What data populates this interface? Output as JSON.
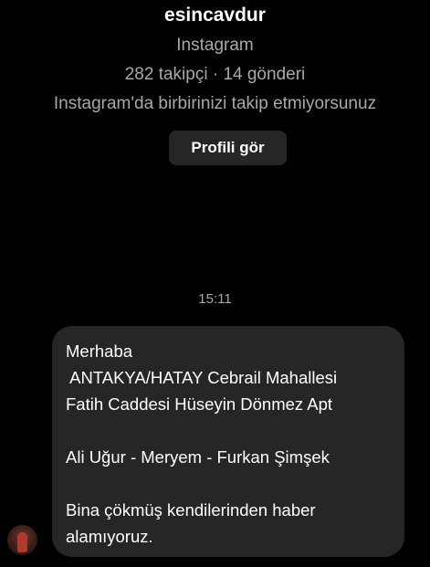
{
  "profile": {
    "username": "esincavdur",
    "app_name": "Instagram",
    "stats": "282 takipçi · 14 gönderi",
    "follow_note": "Instagram'da birbirinizi takip etmiyorsunuz",
    "view_profile_label": "Profili gör"
  },
  "conversation": {
    "timestamp": "15:11",
    "message_lines": [
      "Merhaba",
      " ANTAKYA/HATAY Cebrail Mahallesi",
      "Fatih Caddesi Hüseyin Dönmez Apt",
      "",
      "Ali Uğur - Meryem - Furkan Şimşek",
      "",
      "Bina çökmüş kendilerinden haber",
      "alamıyoruz."
    ]
  },
  "colors": {
    "background": "#000000",
    "bubble": "#262626",
    "secondary_text": "#a8a8a8",
    "button": "#262626"
  }
}
